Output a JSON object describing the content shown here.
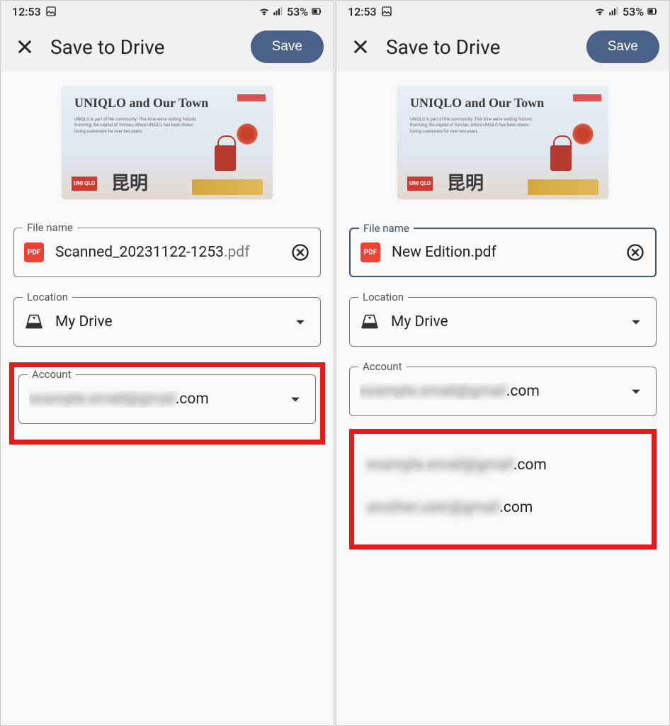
{
  "statusbar": {
    "time": "12:53",
    "battery": "53%"
  },
  "header": {
    "title": "Save to Drive",
    "save_label": "Save"
  },
  "preview": {
    "title": "UNIQLO and Our Town",
    "logo": "UNI QLO",
    "chars": "昆明"
  },
  "labels": {
    "file_name": "File name",
    "location": "Location",
    "account": "Account",
    "pdf": "PDF"
  },
  "left": {
    "file_name": "Scanned_20231122-1253",
    "file_ext": ".pdf",
    "location": "My Drive",
    "account_blur": "example.email@gmail",
    "account_suffix": ".com"
  },
  "right": {
    "file_name": "New Edition.pdf",
    "location": "My Drive",
    "account_blur": "example.email@gmail",
    "account_suffix": ".com",
    "options": [
      {
        "blur": "example.email@gmail",
        "suffix": ".com"
      },
      {
        "blur": "another.user@gmail",
        "suffix": ".com"
      }
    ]
  }
}
